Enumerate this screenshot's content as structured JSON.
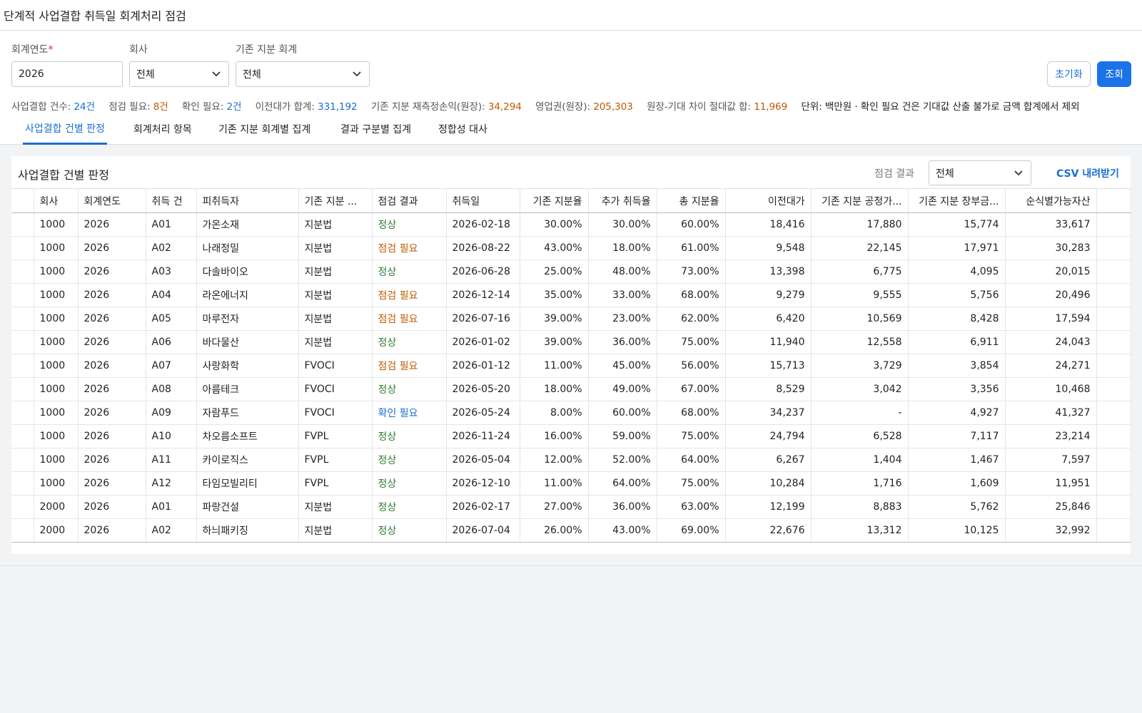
{
  "page": {
    "title": "단계적 사업결합 취득일 회계처리 점검"
  },
  "filters": {
    "year": {
      "label": "회계연도",
      "required_mark": "*",
      "value": "2026"
    },
    "company": {
      "label": "회사",
      "value": "전체"
    },
    "prior_accounting": {
      "label": "기존 지분 회계",
      "value": "전체"
    }
  },
  "buttons": {
    "reset": "초기화",
    "search": "조회"
  },
  "summary": {
    "count_label": "사업결합 건수:",
    "count_value": "24건",
    "check_label": "점검 필요:",
    "check_value": "8건",
    "confirm_label": "확인 필요:",
    "confirm_value": "2건",
    "consideration_label": "이전대가 합계:",
    "consideration_value": "331,192",
    "remeasure_label": "기존 지분 재측정손익(원장):",
    "remeasure_value": "34,294",
    "goodwill_label": "영업권(원장):",
    "goodwill_value": "205,303",
    "diff_label": "원장-기대 차이 절대값 합:",
    "diff_value": "11,969",
    "note": "단위: 백만원 · 확인 필요 건은 기대값 산출 불가로 금액 합계에서 제외"
  },
  "tabs": [
    {
      "label": "사업결합 건별 판정",
      "active": true
    },
    {
      "label": "회계처리 항목",
      "active": false
    },
    {
      "label": "기존 지분 회계별 집계",
      "active": false
    },
    {
      "label": "결과 구분별 집계",
      "active": false
    },
    {
      "label": "정합성 대사",
      "active": false
    }
  ],
  "panel": {
    "title": "사업결합 건별 판정",
    "filter_label": "점검 결과",
    "filter_value": "전체",
    "csv_label": "CSV 내려받기"
  },
  "table": {
    "headers": [
      "회사",
      "회계연도",
      "취득 건",
      "피취득자",
      "기존 지분 ...",
      "점검 결과",
      "취득일",
      "기존 지분율",
      "추가 취득율",
      "총 지분율",
      "이전대가",
      "기존 지분 공정가...",
      "기존 지분 장부금...",
      "순식별가능자산"
    ],
    "rows": [
      [
        "1000",
        "2026",
        "A01",
        "가온소재",
        "지분법",
        "정상",
        "2026-02-18",
        "30.00%",
        "30.00%",
        "60.00%",
        "18,416",
        "17,880",
        "15,774",
        "33,617"
      ],
      [
        "1000",
        "2026",
        "A02",
        "나래정밀",
        "지분법",
        "점검 필요",
        "2026-08-22",
        "43.00%",
        "18.00%",
        "61.00%",
        "9,548",
        "22,145",
        "17,971",
        "30,283"
      ],
      [
        "1000",
        "2026",
        "A03",
        "다솔바이오",
        "지분법",
        "정상",
        "2026-06-28",
        "25.00%",
        "48.00%",
        "73.00%",
        "13,398",
        "6,775",
        "4,095",
        "20,015"
      ],
      [
        "1000",
        "2026",
        "A04",
        "라온에너지",
        "지분법",
        "점검 필요",
        "2026-12-14",
        "35.00%",
        "33.00%",
        "68.00%",
        "9,279",
        "9,555",
        "5,756",
        "20,496"
      ],
      [
        "1000",
        "2026",
        "A05",
        "마루전자",
        "지분법",
        "점검 필요",
        "2026-07-16",
        "39.00%",
        "23.00%",
        "62.00%",
        "6,420",
        "10,569",
        "8,428",
        "17,594"
      ],
      [
        "1000",
        "2026",
        "A06",
        "바다물산",
        "지분법",
        "정상",
        "2026-01-02",
        "39.00%",
        "36.00%",
        "75.00%",
        "11,940",
        "12,558",
        "6,911",
        "24,043"
      ],
      [
        "1000",
        "2026",
        "A07",
        "사랑화학",
        "FVOCI",
        "점검 필요",
        "2026-01-12",
        "11.00%",
        "45.00%",
        "56.00%",
        "15,713",
        "3,729",
        "3,854",
        "24,271"
      ],
      [
        "1000",
        "2026",
        "A08",
        "아름테크",
        "FVOCI",
        "정상",
        "2026-05-20",
        "18.00%",
        "49.00%",
        "67.00%",
        "8,529",
        "3,042",
        "3,356",
        "10,468"
      ],
      [
        "1000",
        "2026",
        "A09",
        "자람푸드",
        "FVOCI",
        "확인 필요",
        "2026-05-24",
        "8.00%",
        "60.00%",
        "68.00%",
        "34,237",
        "-",
        "4,927",
        "41,327"
      ],
      [
        "1000",
        "2026",
        "A10",
        "차오름소프트",
        "FVPL",
        "정상",
        "2026-11-24",
        "16.00%",
        "59.00%",
        "75.00%",
        "24,794",
        "6,528",
        "7,117",
        "23,214"
      ],
      [
        "1000",
        "2026",
        "A11",
        "카이로직스",
        "FVPL",
        "정상",
        "2026-05-04",
        "12.00%",
        "52.00%",
        "64.00%",
        "6,267",
        "1,404",
        "1,467",
        "7,597"
      ],
      [
        "1000",
        "2026",
        "A12",
        "타임모빌리티",
        "FVPL",
        "정상",
        "2026-12-10",
        "11.00%",
        "64.00%",
        "75.00%",
        "10,284",
        "1,716",
        "1,609",
        "11,951"
      ],
      [
        "2000",
        "2026",
        "A01",
        "파랑건설",
        "지분법",
        "정상",
        "2026-02-17",
        "27.00%",
        "36.00%",
        "63.00%",
        "12,199",
        "8,883",
        "5,762",
        "25,846"
      ],
      [
        "2000",
        "2026",
        "A02",
        "하늬패키징",
        "지분법",
        "정상",
        "2026-07-04",
        "26.00%",
        "43.00%",
        "69.00%",
        "22,676",
        "13,312",
        "10,125",
        "32,992"
      ]
    ]
  },
  "colors": {
    "accent": "#1a73e8",
    "status_normal": "#2e7d32",
    "status_check": "#c05a00",
    "status_confirm": "#1a6fd0"
  }
}
